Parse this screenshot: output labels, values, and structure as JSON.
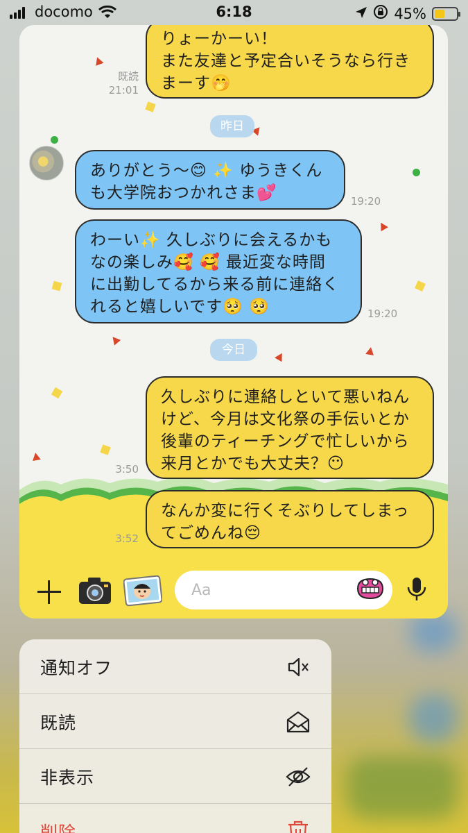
{
  "status_bar": {
    "carrier": "docomo",
    "time": "6:18",
    "battery_percent": "45%",
    "battery_level": 0.45,
    "battery_color": "#f5c518"
  },
  "chat": {
    "messages": [
      {
        "sender": "me",
        "text_lines": [
          "りょーかーい！",
          "また友達と予定合いそうなら行き",
          "まーす🤭"
        ],
        "read_label": "既読",
        "time": "21:01"
      },
      {
        "type": "date",
        "label": "昨日"
      },
      {
        "sender": "them",
        "text_lines": [
          "ありがとう〜😊 ✨ ゆうきくん",
          "も大学院おつかれさま💕"
        ],
        "time": "19:20"
      },
      {
        "sender": "them",
        "text_lines": [
          "わーい✨ 久しぶりに会えるかも",
          "なの楽しみ🥰 🥰 最近変な時間",
          "に出勤してるから来る前に連絡く",
          "れると嬉しいです🥺 🥺"
        ],
        "time": "19:20"
      },
      {
        "type": "date",
        "label": "今日"
      },
      {
        "sender": "me",
        "text_lines": [
          "久しぶりに連絡しといて悪いねん",
          "けど、今月は文化祭の手伝いとか",
          "後輩のティーチングで忙しいから",
          "来月とかでも大丈夫？😶"
        ],
        "time": "3:50"
      },
      {
        "sender": "me",
        "text_lines": [
          "なんか変に行くそぶりしてしまっ",
          "てごめんね😔"
        ],
        "time": "3:52"
      }
    ],
    "input_placeholder": "Aa",
    "icons": [
      "plus-icon",
      "camera-icon",
      "sticker-icon",
      "emoji-icon",
      "mic-icon"
    ],
    "colors": {
      "my_bubble": "#f6d84a",
      "their_bubble": "#7ec4f4",
      "date_pill": "#b9d7ee"
    }
  },
  "context_menu": {
    "items": [
      {
        "label": "通知オフ",
        "icon": "mute-icon"
      },
      {
        "label": "既読",
        "icon": "open-envelope-icon"
      },
      {
        "label": "非表示",
        "icon": "eye-slash-icon"
      },
      {
        "label": "削除",
        "icon": "trash-icon",
        "color": "#e0463a"
      }
    ]
  }
}
